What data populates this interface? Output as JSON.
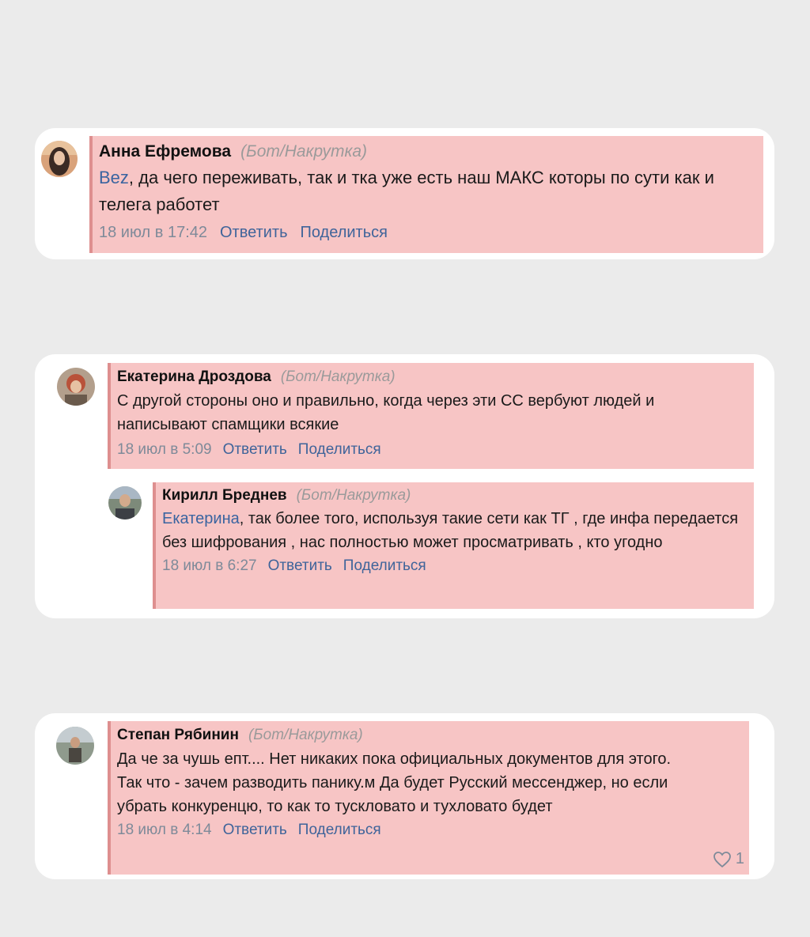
{
  "comments": [
    {
      "author": "Анна Ефремова",
      "tag": "(Бот/Накрутка)",
      "mention": "Bez",
      "text": ", да чего переживать, так и тка уже есть наш МАКС которы по сути как и телега работет",
      "time": "18 июл в 17:42",
      "reply_label": "Ответить",
      "share_label": "Поделиться"
    },
    {
      "author": "Екатерина Дроздова",
      "tag": "(Бот/Накрутка)",
      "text": "С другой стороны оно и правильно, когда через эти СС вербуют людей и написывают спамщики всякие",
      "time": "18 июл в 5:09",
      "reply_label": "Ответить",
      "share_label": "Поделиться"
    },
    {
      "author": "Кирилл Бреднев",
      "tag": "(Бот/Накрутка)",
      "mention": "Екатерина",
      "text": ", так более того, используя такие сети как ТГ , где инфа передается без шифрования , нас полностью может просматривать , кто угодно",
      "time": "18 июл в 6:27",
      "reply_label": "Ответить",
      "share_label": "Поделиться"
    },
    {
      "author": "Степан Рябинин",
      "tag": "(Бот/Накрутка)",
      "text": "Да че за чушь епт.... Нет никаких пока официальных документов для этого. Так что - зачем разводить панику.м Да будет Русский мессенджер, но если убрать конкуренцю, то как то тускловато и тухловато будет",
      "time": "18 июл в 4:14",
      "reply_label": "Ответить",
      "share_label": "Поделиться",
      "likes": "1"
    }
  ],
  "colors": {
    "background": "#ebebeb",
    "highlight": "#f7c5c5",
    "highlight_border": "#de8f8f",
    "link": "#3f649a",
    "muted": "#7e8a99"
  }
}
